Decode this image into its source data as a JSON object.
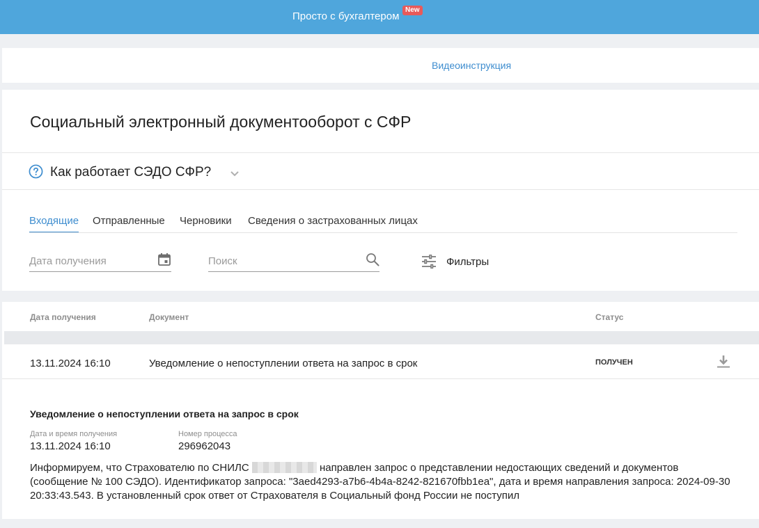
{
  "topbar": {
    "title": "Просто с бухгалтером",
    "badge": "New"
  },
  "video_link": "Видеоинструкция",
  "page_title": "Социальный электронный документооборот с СФР",
  "help": {
    "title": "Как работает СЭДО СФР?"
  },
  "tabs": [
    {
      "label": "Входящие",
      "active": true
    },
    {
      "label": "Отправленные",
      "active": false
    },
    {
      "label": "Черновики",
      "active": false
    },
    {
      "label": "Сведения о застрахованных лицах",
      "active": false
    }
  ],
  "filters": {
    "date_placeholder": "Дата получения",
    "search_placeholder": "Поиск",
    "filters_label": "Фильтры"
  },
  "table": {
    "headers": {
      "date": "Дата получения",
      "document": "Документ",
      "status": "Статус"
    },
    "rows": [
      {
        "date": "13.11.2024 16:10",
        "document": "Уведомление о непоступлении ответа на запрос в срок",
        "status": "ПОЛУЧЕН"
      }
    ]
  },
  "detail": {
    "title": "Уведомление о непоступлении ответа на запрос в срок",
    "received_label": "Дата и время получения",
    "received_value": "13.11.2024 16:10",
    "process_label": "Номер процесса",
    "process_value": "296962043",
    "text_before": "Информируем, что Страхователю по СНИЛС",
    "text_after": "направлен запрос о представлении недостающих сведений и документов (сообщение № 100 СЭДО). Идентификатор запроса: \"3aed4293-a7b6-4b4a-8242-821670fbb1ea\", дата и время направления запроса: 2024-09-30 20:33:43.543. В установленный срок ответ от Страхователя в Социальный фонд России не поступил"
  },
  "colors": {
    "topbar": "#4fa6dc",
    "accent": "#3e8dcf",
    "badge": "#e85a5a"
  },
  "icons": [
    "help-icon",
    "chevron-down-icon",
    "calendar-icon",
    "search-icon",
    "filters-icon",
    "download-icon"
  ]
}
